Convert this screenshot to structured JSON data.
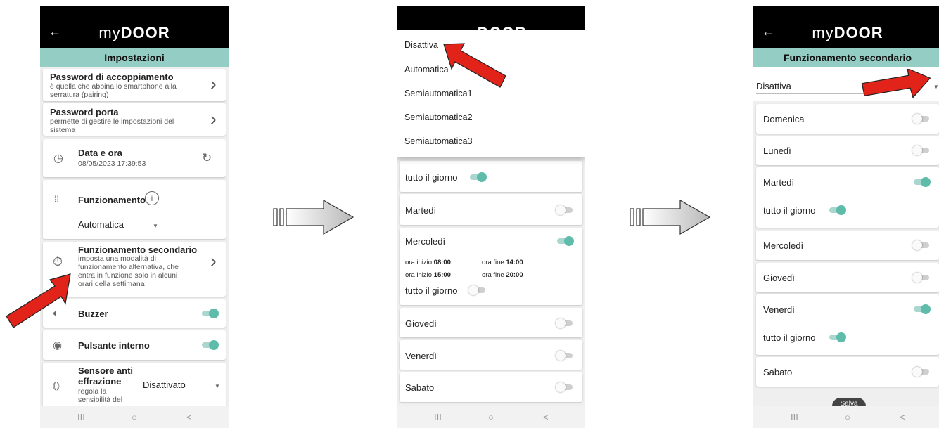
{
  "app": {
    "back": "←",
    "logo_thin": "my",
    "logo_bold": "DOOR"
  },
  "navbar": {
    "recent": "III",
    "home": "○",
    "back": "<"
  },
  "screen1": {
    "title": "Impostazioni",
    "pairing_title": "Password di accoppiamento",
    "pairing_desc_1": "è quella che abbina lo smartphone alla",
    "pairing_desc_2": "serratura (pairing)",
    "door_title": "Password porta",
    "door_desc_1": "permette di gestire le impostazioni del",
    "door_desc_2": "sistema",
    "datetime_title": "Data e ora",
    "datetime_value": "08/05/2023 17:39:53",
    "mode_title": "Funzionamento",
    "mode_value": "Automatica",
    "secondary_title": "Funzionamento secondario",
    "secondary_desc_1": "imposta una modalità di",
    "secondary_desc_2": "funzionamento alternativa, che",
    "secondary_desc_3": "entra in funzione solo in alcuni",
    "secondary_desc_4": "orari della settimana",
    "buzzer": "Buzzer",
    "internal_button": "Pulsante interno",
    "tamper_1": "Sensore anti",
    "tamper_2": "effrazione",
    "tamper_3": "regola la",
    "tamper_4": "sensibilità del",
    "tamper_value": "Disattivato"
  },
  "screen2": {
    "options": [
      "Disattiva",
      "Automatica",
      "Semiautomatica1",
      "Semiautomatica2",
      "Semiautomatica3"
    ],
    "allday": "tutto il giorno",
    "tuesday": "Martedì",
    "wednesday": "Mercoledì",
    "start_label": "ora inizio",
    "end_label": "ora fine",
    "start1": "08:00",
    "end1": "14:00",
    "start2": "15:00",
    "end2": "20:00",
    "thursday": "Giovedì",
    "friday": "Venerdì",
    "saturday": "Sabato"
  },
  "screen3": {
    "title": "Funzionamento secondario",
    "select_value": "Disattiva",
    "days": [
      "Domenica",
      "Lunedì",
      "Martedì",
      "Mercoledì",
      "Giovedì",
      "Venerdì",
      "Sabato"
    ],
    "allday": "tutto il giorno",
    "fab_label": "Salva"
  },
  "colors": {
    "accent": "#94cdc4",
    "toggle_on": "#5fbbaa",
    "arrow": "#e2231a"
  }
}
